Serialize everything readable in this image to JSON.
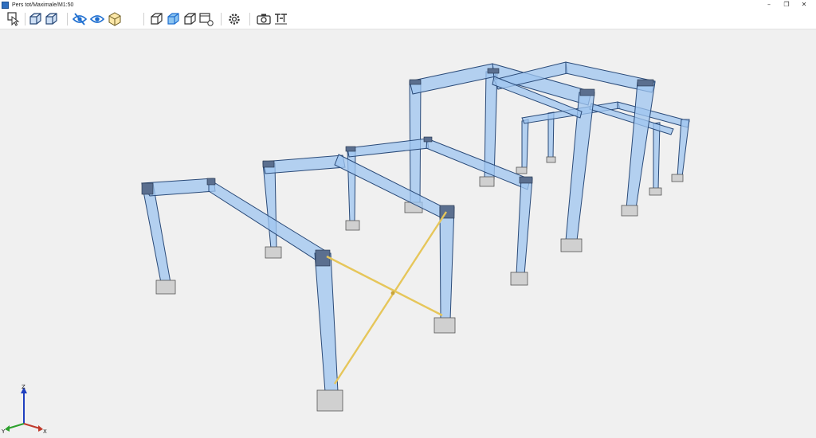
{
  "window": {
    "title": "Pers tot/Maximale/M1:50",
    "controls": {
      "minimize": "–",
      "maximize": "❐",
      "close": "✕"
    }
  },
  "toolbar": {
    "items": [
      {
        "id": "select-view",
        "icon": "select-view-icon",
        "tooltip": ""
      },
      {
        "id": "cube-wire",
        "icon": "cube-wireframe-icon"
      },
      {
        "id": "cube-wire-2",
        "icon": "cube-wireframe-alt-icon"
      },
      {
        "id": "hide",
        "icon": "eye-slash-icon"
      },
      {
        "id": "show",
        "icon": "eye-icon"
      },
      {
        "id": "render",
        "icon": "cube-render-icon"
      },
      {
        "id": "view-iso",
        "icon": "cube-iso-icon"
      },
      {
        "id": "view-front",
        "icon": "cube-front-icon"
      },
      {
        "id": "view-side",
        "icon": "cube-side-icon"
      },
      {
        "id": "view-export",
        "icon": "view-export-icon"
      },
      {
        "id": "settings",
        "icon": "gear-icon"
      },
      {
        "id": "camera",
        "icon": "camera-icon"
      },
      {
        "id": "text",
        "icon": "text-tool-icon"
      }
    ]
  },
  "axes": {
    "z": "Z",
    "y": "Y",
    "x": "X",
    "colors": {
      "x": "#1a1a1a",
      "y": "#2ca02c",
      "z": "#1f3fbf"
    }
  },
  "colors": {
    "steel_fill": "#9fc6f0",
    "steel_stroke": "#2a4a78",
    "brace": "#e6c65a",
    "footing": "#c8c8c8"
  }
}
